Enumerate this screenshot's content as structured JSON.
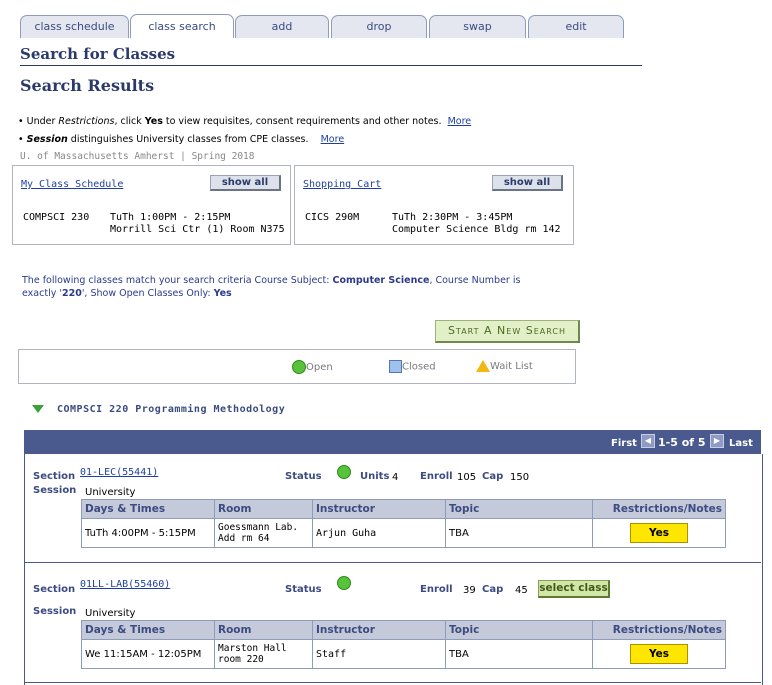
{
  "tabs": [
    "class schedule",
    "class search",
    "add",
    "drop",
    "swap",
    "edit"
  ],
  "active_tab": "class search",
  "page_title": "Search for Classes",
  "section_title": "Search Results",
  "notes": {
    "note1_prefix": "• Under ",
    "note1_em": "Restrictions",
    "note1_mid": ", click ",
    "note1_bold": "Yes",
    "note1_suffix": " to view requisites, consent requirements and other notes.",
    "note1_more": "More",
    "note2_prefix": "• ",
    "note2_em": "Session",
    "note2_suffix": " distinguishes University classes from CPE classes.",
    "note2_more": "More"
  },
  "term": "U. of Massachusetts Amherst | Spring 2018",
  "my_schedule": {
    "title": "My Class Schedule",
    "show_all": "show all",
    "course": "COMPSCI 230",
    "time": "TuTh 1:00PM - 2:15PM",
    "location": "Morrill Sci Ctr (1)  Room N375"
  },
  "cart": {
    "title": "Shopping Cart",
    "show_all": "show all",
    "course": "CICS 290M",
    "time": "TuTh 2:30PM - 3:45PM",
    "location": "Computer Science Bldg rm 142"
  },
  "criteria": {
    "text1": "The following classes match your search criteria Course Subject: ",
    "subject": "Computer Science",
    "text2": ",  Course Number is",
    "text3": "exactly '",
    "number": "220",
    "text4": "',  Show Open Classes Only: ",
    "open_only": "Yes"
  },
  "new_search": "Start A New Search",
  "legend": {
    "open": "Open",
    "closed": "Closed",
    "wait": "Wait List"
  },
  "course_header": "COMPSCI  220 Programming Methodology",
  "nav": {
    "first": "First",
    "range": "1-5 of 5",
    "last": "Last"
  },
  "table_headers": [
    "Days & Times",
    "Room",
    "Instructor",
    "Topic",
    "Restrictions/Notes"
  ],
  "sections": [
    {
      "section_label": "Section",
      "section": "01-LEC(55441)",
      "session_label": "Session",
      "session": "University",
      "status_label": "Status",
      "units_label": "Units",
      "units": "4",
      "enroll_label": "Enroll",
      "enroll": "105",
      "cap_label": "Cap",
      "cap": "150",
      "days": "TuTh 4:00PM - 5:15PM",
      "room": "Goessmann Lab. Add rm 64",
      "instructor": "Arjun Guha",
      "topic": "TBA",
      "restrictions": "Yes"
    },
    {
      "section_label": "Section",
      "section": "01LL-LAB(55460)",
      "session_label": "Session",
      "session": "University",
      "status_label": "Status",
      "enroll_label": "Enroll",
      "enroll": "39",
      "cap_label": "Cap",
      "cap": "45",
      "select": "select class",
      "days": "We 11:15AM - 12:05PM",
      "room": "Marston Hall room 220",
      "instructor": "Staff",
      "topic": "TBA",
      "restrictions": "Yes"
    }
  ]
}
